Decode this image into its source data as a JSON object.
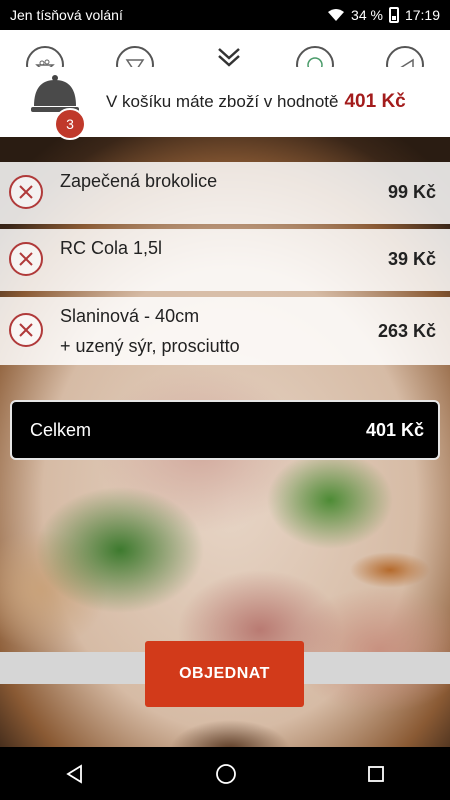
{
  "status_bar": {
    "carrier": "Jen tísňová volání",
    "battery": "34 %",
    "time": "17:19",
    "icons": [
      "wifi-icon",
      "battery-icon"
    ]
  },
  "categories": {
    "icons": [
      "category-salad-icon",
      "category-pizza-icon",
      "category-pasta-icon",
      "category-drink-icon",
      "category-dessert-icon"
    ],
    "collapse_icon": "chevron-double-down-icon"
  },
  "cart_summary": {
    "badge_count": "3",
    "text": "V košíku máte zboží v hodnotě",
    "total": "401 Kč",
    "accent_color": "#a31c1c"
  },
  "cart_items": [
    {
      "name": "Zapečená brokolice",
      "price": "99 Kč"
    },
    {
      "name": "RC Cola 1,5l",
      "price": "39 Kč"
    },
    {
      "name": "Slaninová - 40cm",
      "note": "+ uzený sýr, prosciutto",
      "price": "263 Kč"
    }
  ],
  "total": {
    "label": "Celkem",
    "amount": "401 Kč"
  },
  "order_button": {
    "label": "OBJEDNAT",
    "color": "#d23a1a"
  },
  "navbar": {
    "icons": [
      "back-icon",
      "home-icon",
      "recents-icon"
    ]
  }
}
